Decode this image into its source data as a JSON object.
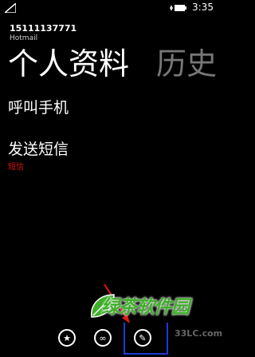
{
  "status_bar": {
    "time": "3:35"
  },
  "contact": {
    "name": "15111137771",
    "account": "Hotmail"
  },
  "pivot": {
    "tabs": [
      {
        "label": "个人资料",
        "active": true
      },
      {
        "label": "历史",
        "active": false
      }
    ]
  },
  "actions": [
    {
      "title": "呼叫手机",
      "subtitle": ""
    },
    {
      "title": "发送短信",
      "subtitle": "短信"
    }
  ],
  "app_bar": {
    "buttons": [
      {
        "icon": "star-icon"
      },
      {
        "icon": "link-icon"
      },
      {
        "icon": "edit-icon",
        "highlighted": true
      }
    ],
    "highlight_color": "#1a3ad6"
  },
  "watermark": {
    "text": "绿茶软件园",
    "sub": "33LC.com"
  },
  "colors": {
    "background": "#000000",
    "sms_label": "#e01010",
    "inactive_tab": "#777777",
    "arrow": "#e01818",
    "watermark": "#3fae2a"
  }
}
